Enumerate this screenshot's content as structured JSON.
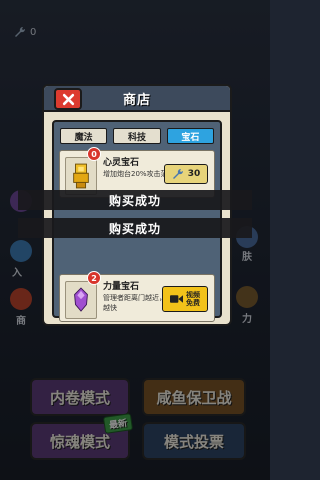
{
  "currency": {
    "icon": "wrench-icon",
    "value": "0"
  },
  "background": {
    "side_labels": [
      "入",
      "商",
      "肤",
      "力"
    ],
    "buttons": [
      {
        "label": "内卷模式"
      },
      {
        "label": "咸鱼保卫战"
      },
      {
        "label": "惊魂模式",
        "badge": "最新"
      },
      {
        "label": "模式投票"
      }
    ]
  },
  "shop": {
    "title": "商店",
    "tabs": [
      {
        "label": "魔法",
        "active": false
      },
      {
        "label": "科技",
        "active": false
      },
      {
        "label": "宝石",
        "active": true
      }
    ],
    "items": [
      {
        "level": "0",
        "name": "心灵宝石",
        "desc": "增加炮台20%攻击范围",
        "price": "30",
        "icon": "gold-gem-icon"
      },
      {
        "level": "2",
        "name": "力量宝石",
        "desc": "管理者距离门越近，攻速越快",
        "video_label": [
          "视频",
          "免费"
        ],
        "icon": "purple-gem-icon"
      }
    ]
  },
  "toasts": [
    "购买成功",
    "购买成功"
  ],
  "colors": {
    "tab_active": "#2ea3e0",
    "close": "#dd3b2f",
    "video_button": "#f2c21a"
  }
}
